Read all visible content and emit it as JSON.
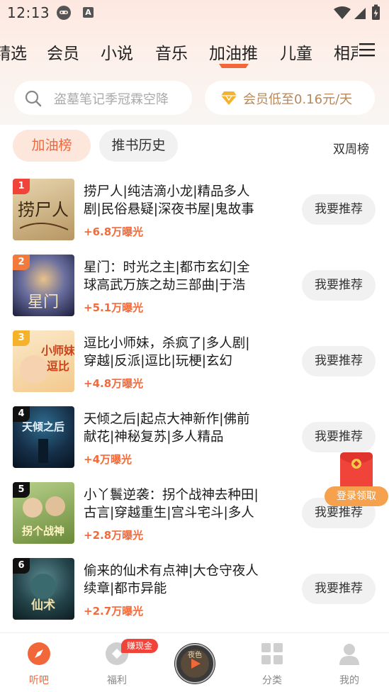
{
  "status_bar": {
    "time": "12:13",
    "icon_letter": "A"
  },
  "category_tabs": [
    {
      "label": "精选",
      "active": false
    },
    {
      "label": "会员",
      "active": false
    },
    {
      "label": "小说",
      "active": false
    },
    {
      "label": "音乐",
      "active": false
    },
    {
      "label": "加油推",
      "active": true
    },
    {
      "label": "儿童",
      "active": false
    },
    {
      "label": "相声",
      "active": false
    }
  ],
  "search": {
    "placeholder": "盗墓笔记季冠霖空降"
  },
  "vip_banner": {
    "text": "会员低至0.16元/天"
  },
  "sub_tabs": {
    "active": "加油榜",
    "other": "推书历史",
    "right_label": "双周榜"
  },
  "list": [
    {
      "rank": "1",
      "title": "捞尸人|纯洁滴小龙|精品多人剧|民俗悬疑|深夜书屋|鬼故事",
      "exposure": "+6.8万曝光",
      "button": "我要推荐",
      "rank_color": "#f0433a"
    },
    {
      "rank": "2",
      "title": "星门：时光之主|都市玄幻|全球高武万族之劫三部曲|于浩",
      "exposure": "+5.1万曝光",
      "button": "我要推荐",
      "rank_color": "#f37a3d"
    },
    {
      "rank": "3",
      "title": "逗比小师妹，杀疯了|多人剧|穿越|反派|逗比|玩梗|玄幻",
      "exposure": "+4.8万曝光",
      "button": "我要推荐",
      "rank_color": "#f5b32c"
    },
    {
      "rank": "4",
      "title": "天倾之后|起点大神新作|佛前献花|神秘复苏|多人精品",
      "exposure": "+4万曝光",
      "button": "我要推荐",
      "rank_color": "#111111"
    },
    {
      "rank": "5",
      "title": "小丫鬟逆袭：拐个战神去种田|古言|穿越重生|宫斗宅斗|多人",
      "exposure": "+2.8万曝光",
      "button": "我要推荐",
      "rank_color": "#111111"
    },
    {
      "rank": "6",
      "title": "偷来的仙术有点神|大仓守夜人续章|都市异能",
      "exposure": "+2.7万曝光",
      "button": "我要推荐",
      "rank_color": "#111111"
    }
  ],
  "covers": {
    "c1": "捞尸人",
    "c2": "星门",
    "c3": "小师妹",
    "c3b": "逗比",
    "c4": "天倾之后",
    "c5": "拐个战神",
    "c6": "仙术"
  },
  "floating": {
    "label": "登录领取"
  },
  "bottom_nav": {
    "items": [
      {
        "label": "听吧",
        "active": true
      },
      {
        "label": "福利",
        "active": false
      },
      {
        "label": "分类",
        "active": false
      },
      {
        "label": "我的",
        "active": false
      }
    ],
    "cash_badge": "赚现金",
    "disc_text": "夜色"
  },
  "colors": {
    "accent": "#f2673a",
    "vip": "#b8875a",
    "badge": "#f0433a"
  }
}
